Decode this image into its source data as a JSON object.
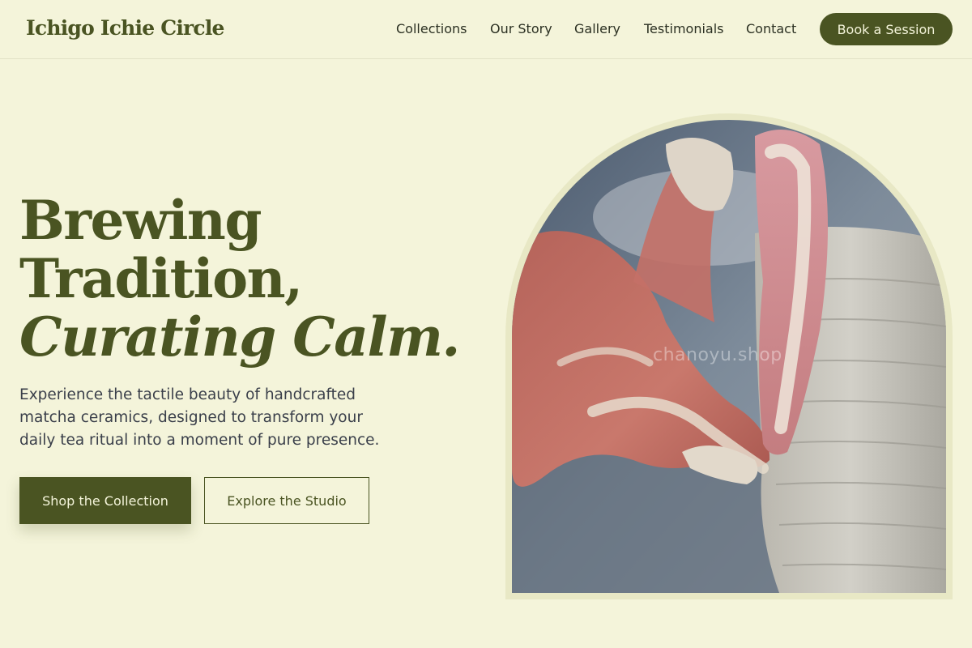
{
  "brand": {
    "name": "Ichigo Ichie Circle"
  },
  "nav": {
    "items": [
      {
        "label": "Collections"
      },
      {
        "label": "Our Story"
      },
      {
        "label": "Gallery"
      },
      {
        "label": "Testimonials"
      },
      {
        "label": "Contact"
      }
    ],
    "cta_label": "Book a Session"
  },
  "hero": {
    "headline_line1": "Brewing",
    "headline_line2": "Tradition,",
    "headline_line3": "Curating Calm.",
    "subtitle": "Experience the tactile beauty of handcrafted matcha ceramics, designed to transform your daily tea ritual into a moment of pure presence.",
    "primary_button": "Shop the Collection",
    "secondary_button": "Explore the Studio",
    "image_watermark": "chanoyu.shop"
  },
  "colors": {
    "background": "#f4f4da",
    "accent": "#4a5422",
    "frame": "#e8e8c5"
  }
}
